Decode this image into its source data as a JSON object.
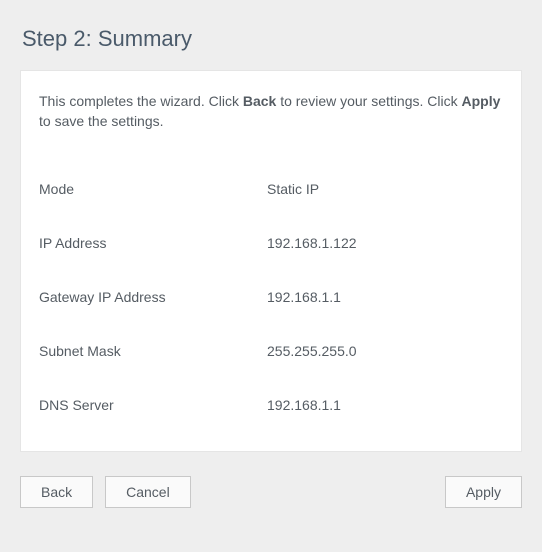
{
  "title": "Step 2: Summary",
  "instruction": {
    "part1": "This completes the wizard. Click ",
    "bold1": "Back",
    "part2": " to review your settings. Click ",
    "bold2": "Apply",
    "part3": " to save the settings."
  },
  "rows": [
    {
      "label": "Mode",
      "value": "Static IP"
    },
    {
      "label": "IP Address",
      "value": "192.168.1.122"
    },
    {
      "label": "Gateway IP Address",
      "value": "192.168.1.1"
    },
    {
      "label": "Subnet Mask",
      "value": "255.255.255.0"
    },
    {
      "label": "DNS Server",
      "value": "192.168.1.1"
    }
  ],
  "buttons": {
    "back": "Back",
    "cancel": "Cancel",
    "apply": "Apply"
  }
}
